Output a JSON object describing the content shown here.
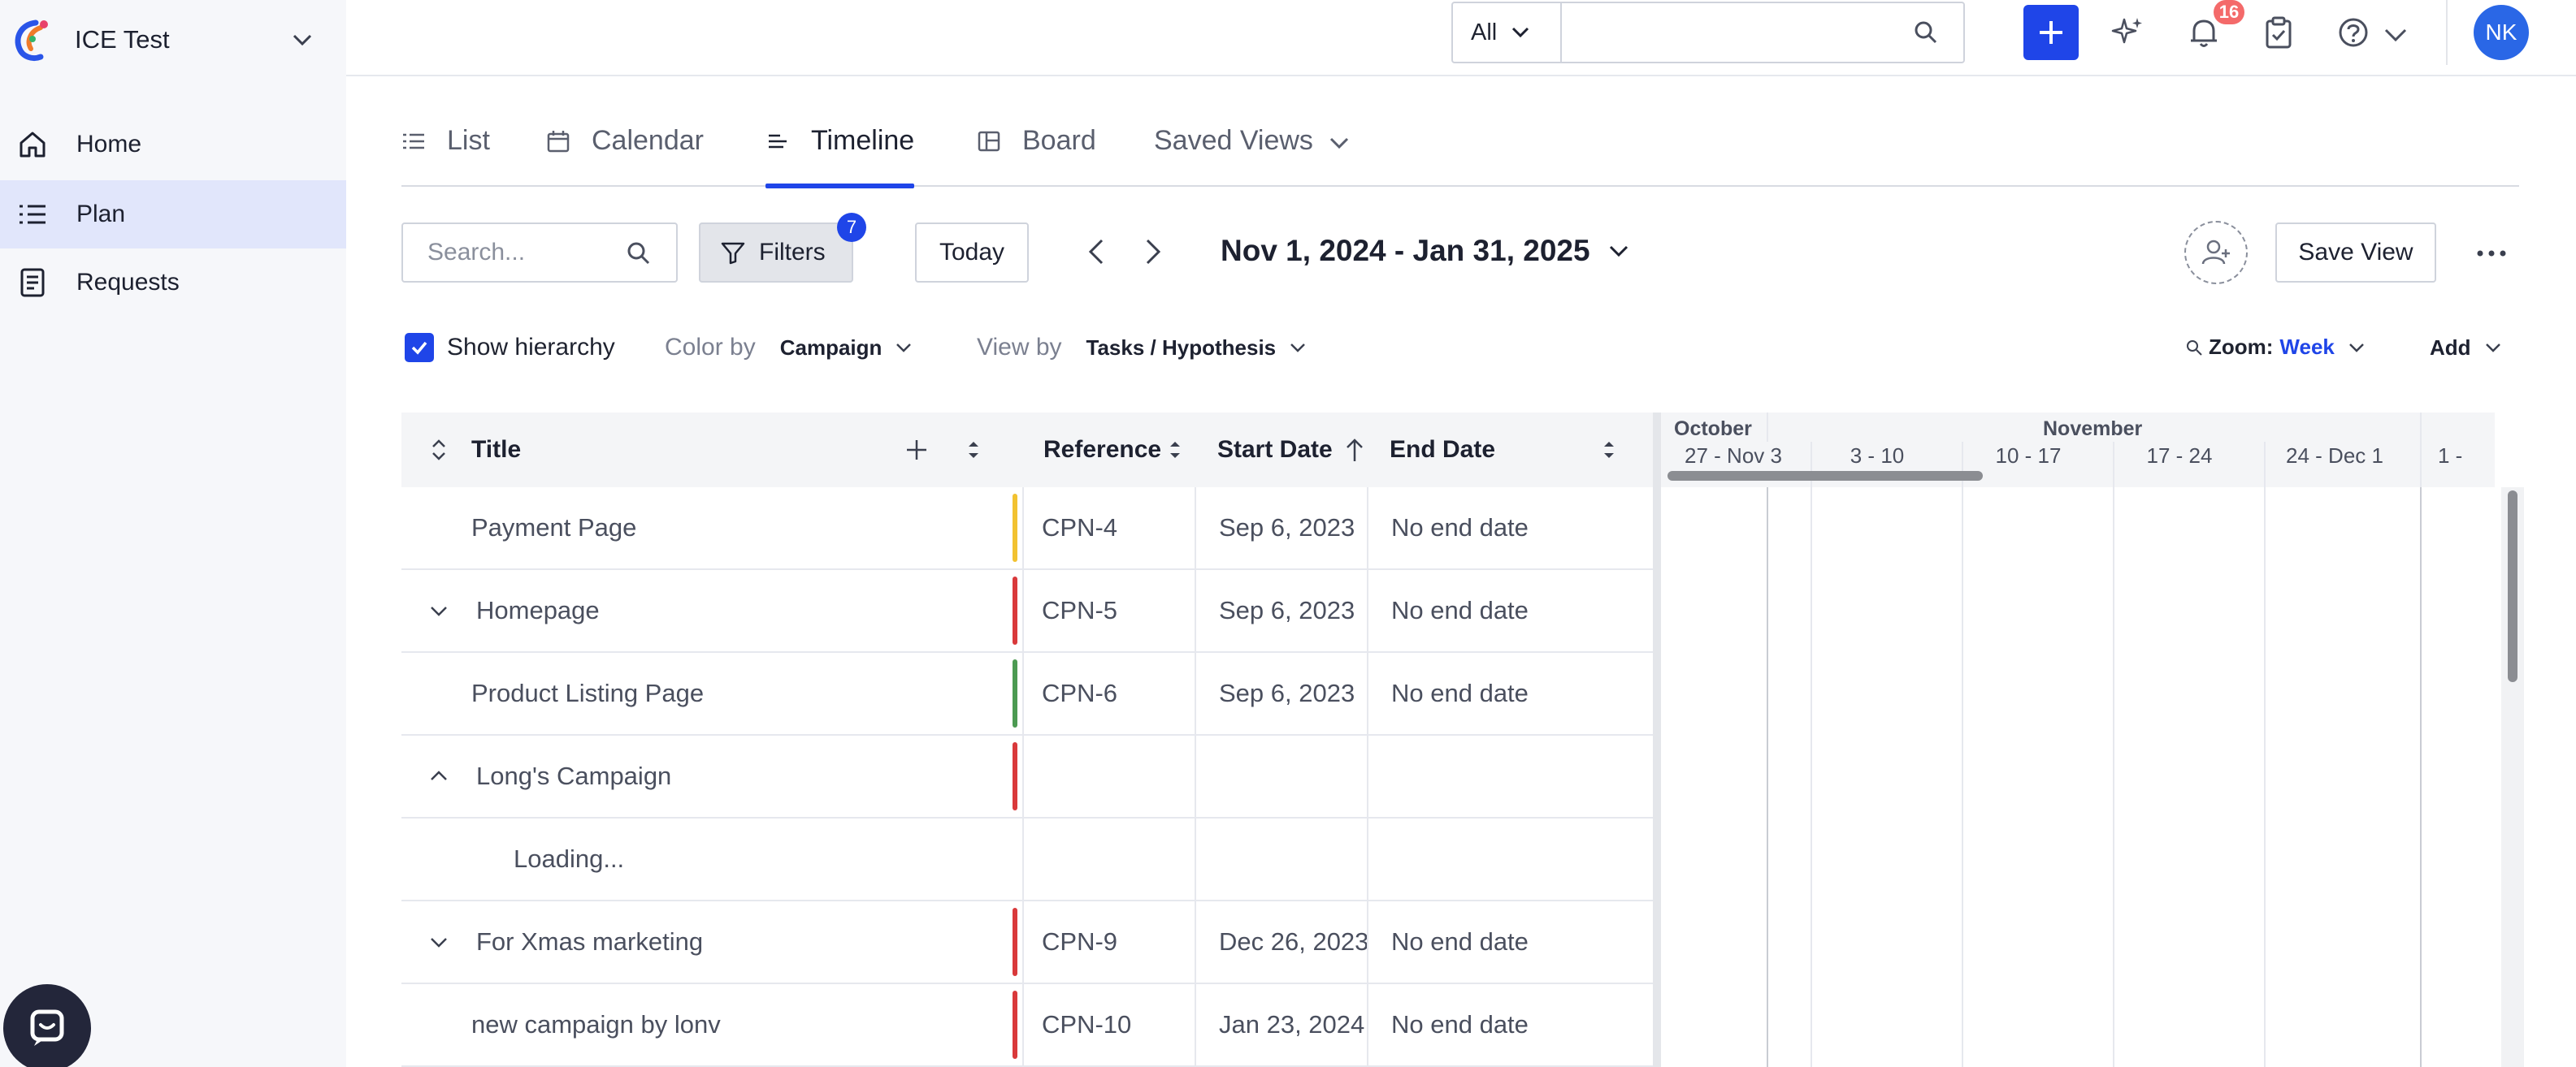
{
  "workspace": {
    "name": "ICE Test"
  },
  "sidebar": {
    "items": [
      {
        "label": "Home",
        "icon": "home-icon"
      },
      {
        "label": "Plan",
        "icon": "list-icon",
        "active": true
      },
      {
        "label": "Requests",
        "icon": "document-icon"
      }
    ]
  },
  "topbar": {
    "scope": "All",
    "search_value": "",
    "notifications_count": "16",
    "avatar_initials": "NK"
  },
  "tabs": [
    {
      "label": "List",
      "icon": "list-icon"
    },
    {
      "label": "Calendar",
      "icon": "calendar-icon"
    },
    {
      "label": "Timeline",
      "icon": "timeline-icon",
      "active": true
    },
    {
      "label": "Board",
      "icon": "board-icon"
    },
    {
      "label": "Saved Views",
      "icon": "chevron-down-icon"
    }
  ],
  "toolbar": {
    "search_placeholder": "Search...",
    "filters_label": "Filters",
    "filters_count": "7",
    "today_label": "Today",
    "date_range": "Nov 1, 2024 - Jan 31, 2025",
    "save_view_label": "Save View"
  },
  "options": {
    "show_hierarchy_label": "Show hierarchy",
    "show_hierarchy_checked": true,
    "color_by_label": "Color by",
    "color_by_value": "Campaign",
    "view_by_label": "View by",
    "view_by_value": "Tasks / Hypothesis",
    "zoom_label": "Zoom:",
    "zoom_value": "Week",
    "add_label": "Add"
  },
  "table": {
    "headers": {
      "title": "Title",
      "reference": "Reference",
      "start_date": "Start Date",
      "end_date": "End Date"
    },
    "rows": [
      {
        "title": "Payment Page",
        "reference": "CPN-4",
        "start": "Sep 6, 2023",
        "end": "No end date",
        "color": "#f2c230",
        "expander": ""
      },
      {
        "title": "Homepage",
        "reference": "CPN-5",
        "start": "Sep 6, 2023",
        "end": "No end date",
        "color": "#d9393b",
        "expander": "down"
      },
      {
        "title": "Product Listing Page",
        "reference": "CPN-6",
        "start": "Sep 6, 2023",
        "end": "No end date",
        "color": "#4c9a52",
        "expander": ""
      },
      {
        "title": "Long's Campaign",
        "reference": "",
        "start": "",
        "end": "",
        "color": "#d9393b",
        "expander": "up"
      },
      {
        "title": "Loading...",
        "reference": "",
        "start": "",
        "end": "",
        "color": "",
        "expander": "",
        "loading": true
      },
      {
        "title": "For Xmas marketing",
        "reference": "CPN-9",
        "start": "Dec 26, 2023",
        "end": "No end date",
        "color": "#d9393b",
        "expander": "down"
      },
      {
        "title": "new campaign by lonv",
        "reference": "CPN-10",
        "start": "Jan 23, 2024",
        "end": "No end date",
        "color": "#d9393b",
        "expander": ""
      }
    ]
  },
  "timeline": {
    "months": [
      "October",
      "November"
    ],
    "weeks": [
      "27 - Nov 3",
      "3 - 10",
      "10 - 17",
      "17 - 24",
      "24 - Dec 1",
      "1 -"
    ]
  }
}
